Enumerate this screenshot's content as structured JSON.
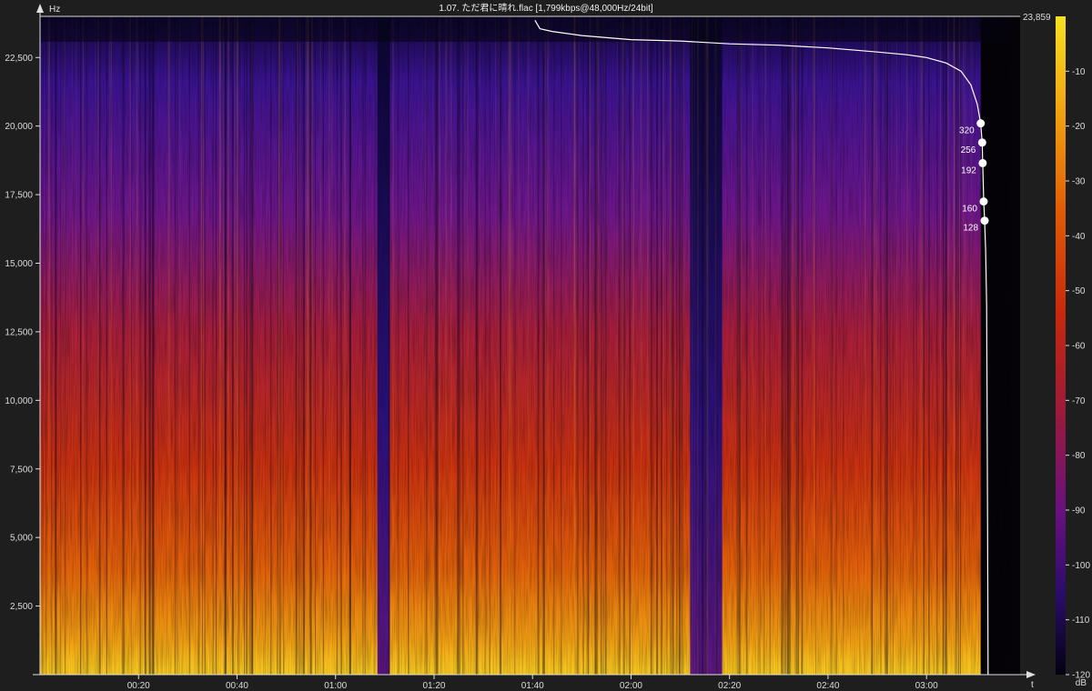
{
  "title": "1.07. ただ君に晴れ.flac [1,799kbps@48,000Hz/24bit]",
  "colors": {
    "background": "#1e1e1e",
    "axis": "#e0e0e0",
    "cutoff_line": "#ffffff",
    "colormap": [
      "#05030f",
      "#1b0a4a",
      "#3a0f8a",
      "#6a1080",
      "#9c1a3a",
      "#c8280c",
      "#e05a06",
      "#f0a010",
      "#f7d020"
    ]
  },
  "chart_data": {
    "type": "heatmap",
    "subtype": "spectrogram",
    "title": "1.07. ただ君に晴れ.flac [1,799kbps@48,000Hz/24bit]",
    "xlabel": "t",
    "ylabel": "Hz",
    "x_ticks": [
      "00:20",
      "00:40",
      "01:00",
      "01:20",
      "01:40",
      "02:00",
      "02:20",
      "02:40",
      "03:00"
    ],
    "y_ticks": [
      "2,500",
      "5,000",
      "7,500",
      "10,000",
      "12,500",
      "15,000",
      "17,500",
      "20,000",
      "22,500"
    ],
    "y_tick_values": [
      2500,
      5000,
      7500,
      10000,
      12500,
      15000,
      17500,
      20000,
      22500
    ],
    "x_tick_seconds": [
      20,
      40,
      60,
      80,
      100,
      120,
      140,
      160,
      180
    ],
    "x_range_seconds": [
      0,
      199
    ],
    "audio_end_seconds": 191,
    "ylim": [
      0,
      24000
    ],
    "max_frequency_label": "23,859",
    "max_frequency": 23859,
    "colorbar": {
      "label": "dB",
      "ticks": [
        "-10",
        "-20",
        "-30",
        "-40",
        "-50",
        "-60",
        "-70",
        "-80",
        "-90",
        "-100",
        "-110",
        "-120"
      ],
      "tick_values": [
        -10,
        -20,
        -30,
        -40,
        -50,
        -60,
        -70,
        -80,
        -90,
        -100,
        -110,
        -120
      ],
      "range": [
        -120,
        0
      ]
    },
    "quiet_segments_seconds": [
      [
        68.5,
        71.0
      ],
      [
        132.0,
        138.5
      ]
    ],
    "bitrate_markers": [
      {
        "label": "320",
        "frequency": 20100,
        "time": 191.0
      },
      {
        "label": "256",
        "frequency": 19400,
        "time": 191.3
      },
      {
        "label": "192",
        "frequency": 18650,
        "time": 191.4
      },
      {
        "label": "160",
        "frequency": 17250,
        "time": 191.6
      },
      {
        "label": "128",
        "frequency": 16550,
        "time": 191.8
      }
    ],
    "cutoff_curve": [
      {
        "t": 100.5,
        "hz": 23859
      },
      {
        "t": 101.5,
        "hz": 23550
      },
      {
        "t": 104,
        "hz": 23450
      },
      {
        "t": 110,
        "hz": 23300
      },
      {
        "t": 120,
        "hz": 23150
      },
      {
        "t": 130,
        "hz": 23100
      },
      {
        "t": 140,
        "hz": 23000
      },
      {
        "t": 150,
        "hz": 22950
      },
      {
        "t": 160,
        "hz": 22850
      },
      {
        "t": 170,
        "hz": 22700
      },
      {
        "t": 176,
        "hz": 22600
      },
      {
        "t": 180,
        "hz": 22500
      },
      {
        "t": 184,
        "hz": 22300
      },
      {
        "t": 187,
        "hz": 22000
      },
      {
        "t": 189,
        "hz": 21500
      },
      {
        "t": 190.3,
        "hz": 20800
      },
      {
        "t": 191.0,
        "hz": 20100
      },
      {
        "t": 191.3,
        "hz": 19400
      },
      {
        "t": 191.4,
        "hz": 18650
      },
      {
        "t": 191.6,
        "hz": 17250
      },
      {
        "t": 191.8,
        "hz": 16550
      },
      {
        "t": 192.0,
        "hz": 15500
      },
      {
        "t": 192.2,
        "hz": 13500
      },
      {
        "t": 192.3,
        "hz": 10000
      },
      {
        "t": 192.4,
        "hz": 5000
      },
      {
        "t": 192.5,
        "hz": 0
      }
    ]
  }
}
